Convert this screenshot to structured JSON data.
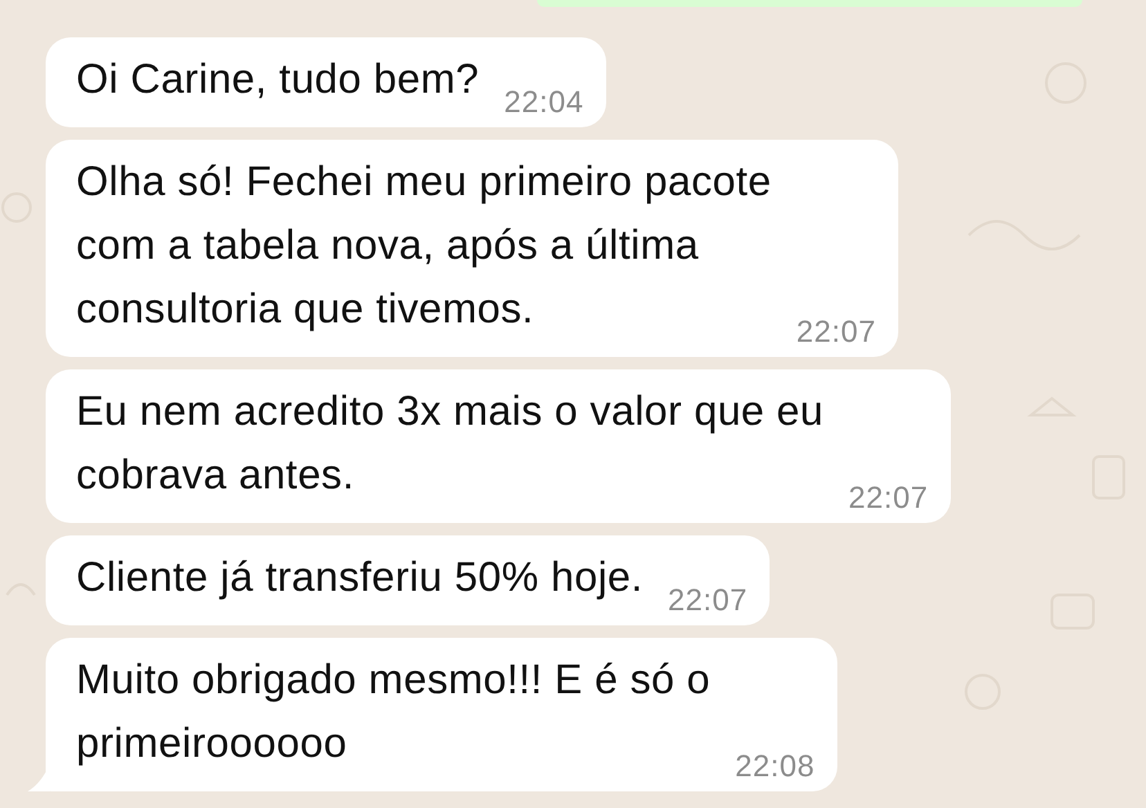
{
  "cut_off_bubble": {
    "kind": "outgoing"
  },
  "messages": [
    {
      "kind": "incoming",
      "text": "Oi Carine, tudo bem?",
      "time": "22:04",
      "tail": false
    },
    {
      "kind": "incoming",
      "text": "Olha só! Fechei meu primeiro pacote\ncom a tabela nova, após a última\nconsultoria que tivemos.",
      "time": "22:07",
      "tail": false
    },
    {
      "kind": "incoming",
      "text": "Eu nem acredito 3x mais o valor que eu\ncobrava antes.",
      "time": "22:07",
      "tail": false
    },
    {
      "kind": "incoming",
      "text": "Cliente já transferiu 50% hoje.",
      "time": "22:07",
      "tail": false
    },
    {
      "kind": "incoming",
      "text": "Muito obrigado mesmo!!! E é só o\nprimeiroooooo",
      "time": "22:08",
      "tail": true
    }
  ]
}
